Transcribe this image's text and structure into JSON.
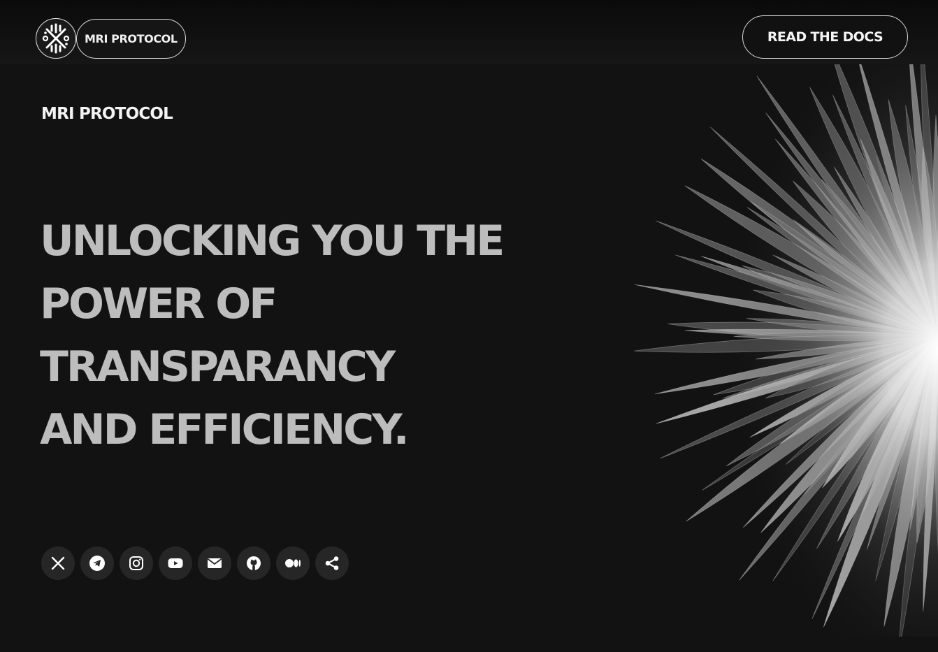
{
  "header": {
    "brand_label": "MRI PROTOCOL",
    "docs_button_label": "READ THE DOCS"
  },
  "hero": {
    "kicker": "MRI PROTOCOL",
    "headline_lines": [
      "UNLOCKING YOU THE",
      "POWER OF",
      "TRANSPARANCY",
      "AND EFFICIENCY."
    ]
  },
  "socials": [
    {
      "icon": "x-twitter-icon"
    },
    {
      "icon": "telegram-icon"
    },
    {
      "icon": "instagram-icon"
    },
    {
      "icon": "youtube-icon"
    },
    {
      "icon": "email-icon"
    },
    {
      "icon": "github-icon"
    },
    {
      "icon": "medium-icon"
    },
    {
      "icon": "share-icon"
    }
  ],
  "colors": {
    "background": "#121212",
    "headline": "#bdbdbd",
    "social_bg": "#262626",
    "accent_white": "#ffffff"
  }
}
